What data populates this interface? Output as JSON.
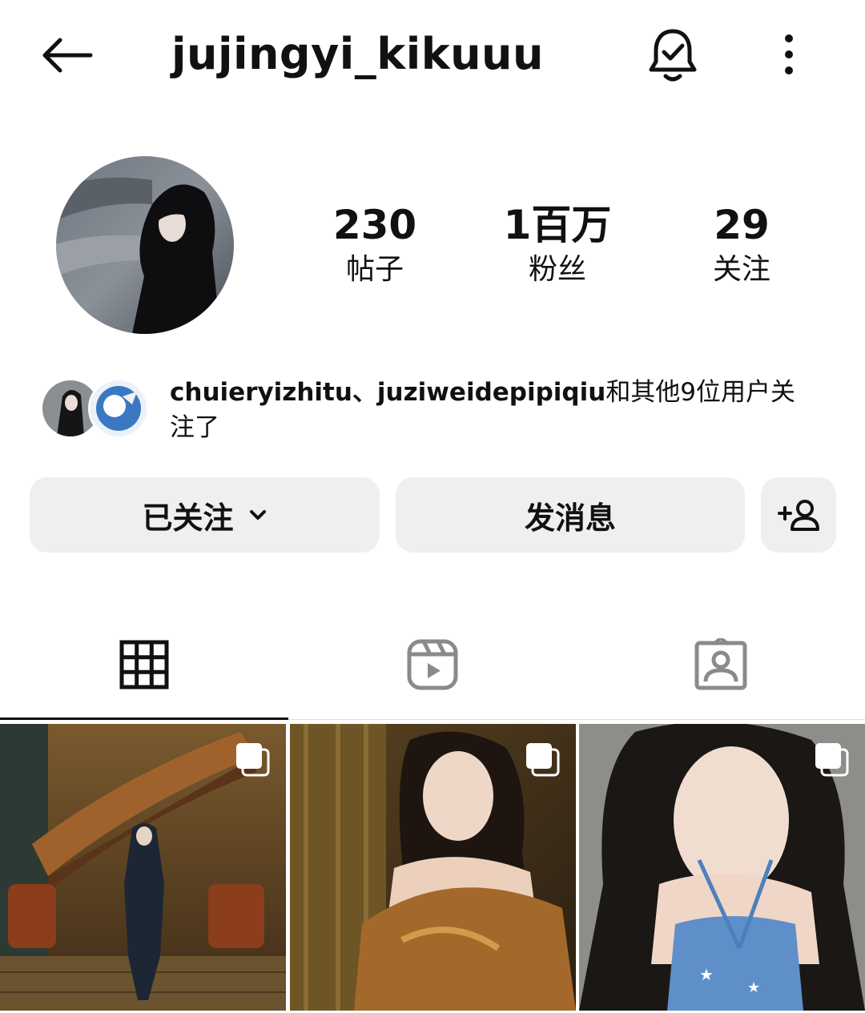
{
  "header": {
    "username": "jujingyi_kikuuu",
    "back_icon": "arrow-left-icon",
    "bell_icon": "bell-check-icon",
    "more_icon": "more-vertical-icon"
  },
  "stats": [
    {
      "value": "230",
      "label": "帖子"
    },
    {
      "value": "1百万",
      "label": "粉丝"
    },
    {
      "value": "29",
      "label": "关注"
    }
  ],
  "followed_by": {
    "users": "chuieryizhitu、juziweidepipiqiu",
    "rest_line1": "和其他9位用户关",
    "rest_line2": "注了"
  },
  "buttons": {
    "following": "已关注",
    "message": "发消息"
  },
  "tabs": [
    "grid-icon",
    "reels-icon",
    "tagged-icon"
  ],
  "colors": {
    "button_bg": "#efefef",
    "text": "#111111",
    "divider": "#dcdcdc"
  }
}
